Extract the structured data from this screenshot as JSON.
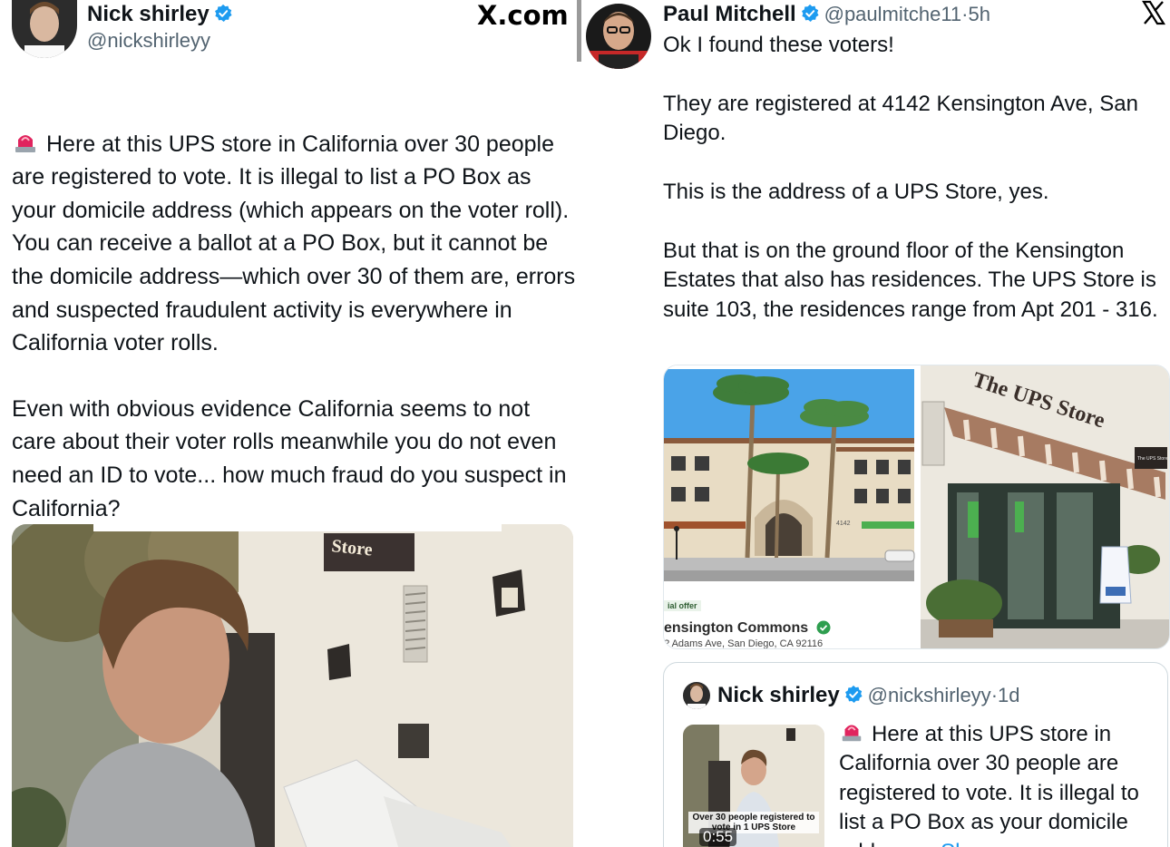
{
  "left_tweet": {
    "author_name": "Nick shirley",
    "author_handle": "@nickshirleyy",
    "source_mark": "X.com",
    "paragraph_1": "Here at this UPS store in California over 30 people are registered to vote. It is illegal to list a PO Box as your domicile address (which appears on the voter roll). You can receive a ballot at a PO Box, but it cannot be the domicile address—which over 30 of them are, errors and suspected fraudulent activity is everywhere in California voter rolls.",
    "paragraph_2": "Even with obvious evidence California seems to not care about their voter rolls meanwhile you do not even need an ID to vote... how much fraud do you suspect in California?",
    "video_sign_text": "Store"
  },
  "right_tweet": {
    "author_name": "Paul Mitchell",
    "author_handle": "@paulmitche11",
    "separator": "·",
    "time": "5h",
    "close_mark": "X",
    "line_1": "Ok I found these voters!",
    "para_2": "They are registered at 4142 Kensington Ave, San Diego.",
    "para_3": "This is the address of a UPS Store, yes.",
    "para_4": "But that is on the ground floor of the Kensington Estates that also has residences.  The UPS Store is suite 103, the residences range from Apt 201 - 316.",
    "listing": {
      "offer_label": "ial offer",
      "title": "ensington Commons",
      "address": "? Adams Ave, San Diego, CA 92116",
      "building_number": "4142"
    },
    "store_photo": {
      "awning_sign": "The UPS Store",
      "hanging_sign": "The UPS Store"
    },
    "quoted": {
      "author_name": "Nick shirley",
      "author_handle": "@nickshirleyy",
      "separator": "·",
      "time": "1d",
      "text": "Here at this UPS store in California over 30 people are registered to vote. It is illegal to list a PO Box as your domicile address",
      "show_more": "Show more",
      "thumb_caption": "Over 30 people registered to vote in 1 UPS Store",
      "thumb_duration": "0:55"
    }
  },
  "colors": {
    "verified_blue": "#1d9bf0",
    "link_blue": "#1d9bf0",
    "text_primary": "#0f1419",
    "text_secondary": "#536471"
  },
  "icons": [
    "siren-icon",
    "verified-badge-icon",
    "x-logo-icon",
    "checkmark-icon"
  ]
}
